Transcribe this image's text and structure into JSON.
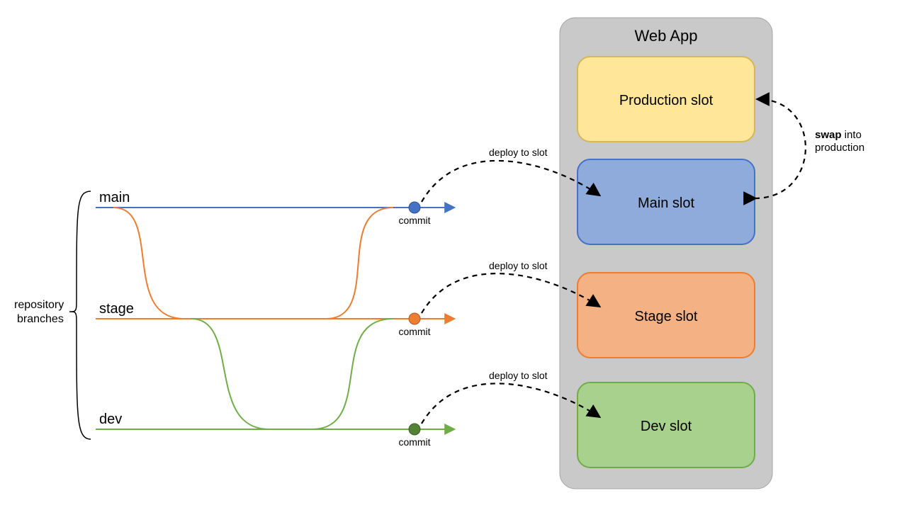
{
  "title": "Web App",
  "sideLabel1": "repository",
  "sideLabel2": "branches",
  "branches": [
    {
      "name": "main",
      "color": "#4472C4",
      "commitLabel": "commit",
      "deployLabel": "deploy to slot"
    },
    {
      "name": "stage",
      "color": "#ED7D31",
      "commitLabel": "commit",
      "deployLabel": "deploy to slot"
    },
    {
      "name": "dev",
      "color": "#70AD47",
      "commitLabel": "commit",
      "deployLabel": "deploy to slot"
    }
  ],
  "slots": [
    {
      "name": "Production slot",
      "fill": "#FFE699",
      "stroke": "#D6B656"
    },
    {
      "name": "Main slot",
      "fill": "#8FABDC",
      "stroke": "#4472C4"
    },
    {
      "name": "Stage slot",
      "fill": "#F4B183",
      "stroke": "#ED7D31"
    },
    {
      "name": "Dev slot",
      "fill": "#A9D18E",
      "stroke": "#70AD47"
    }
  ],
  "swapLabelBold": "swap",
  "swapLabelRest1": " into",
  "swapLabelRest2": "production",
  "colors": {
    "container": "#C9C9C9",
    "containerStroke": "#A6A6A6",
    "dash": "#000000"
  }
}
